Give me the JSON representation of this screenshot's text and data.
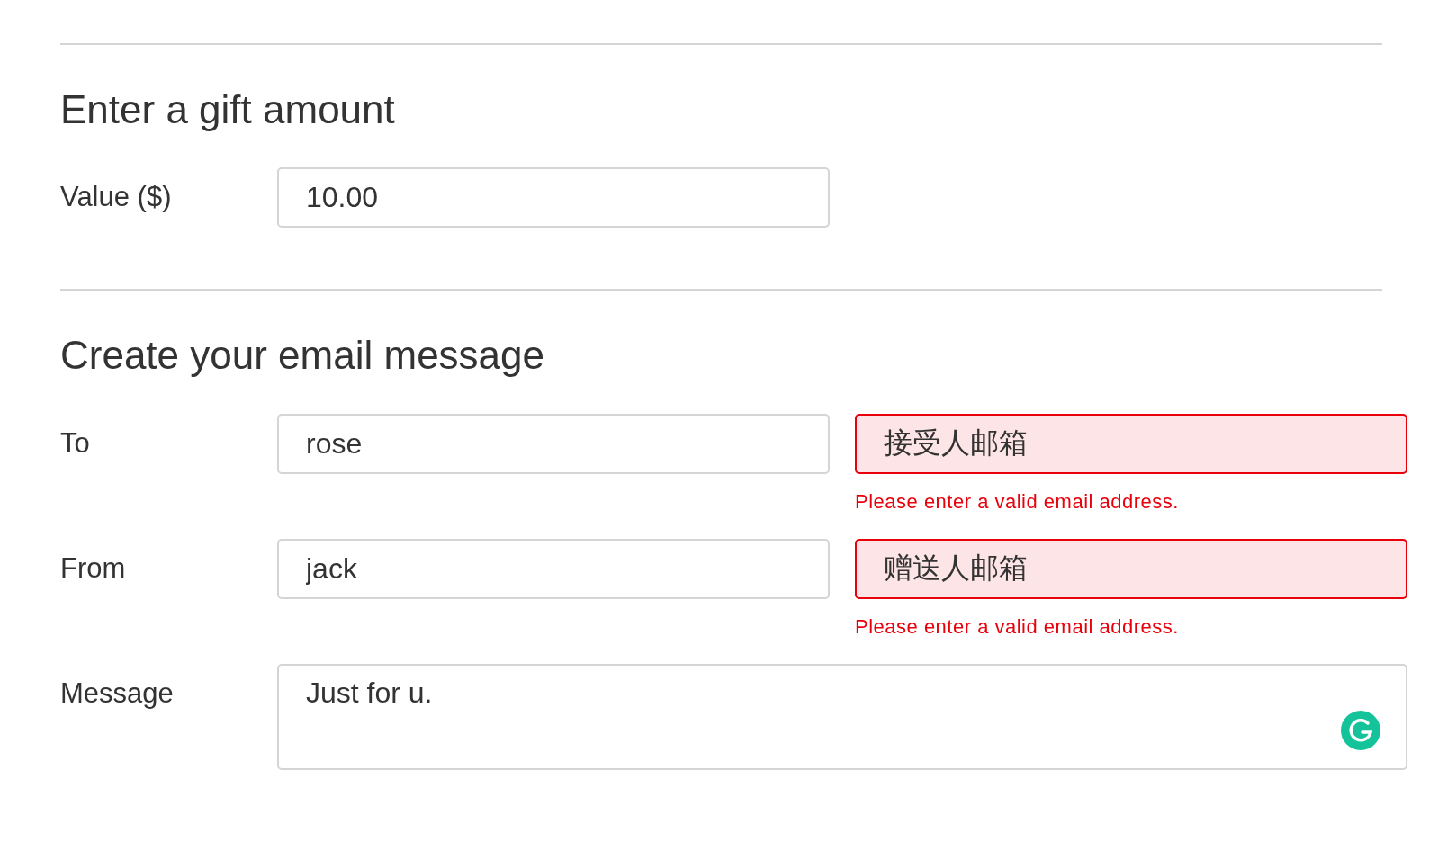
{
  "sections": [
    {
      "title": "Enter a gift amount",
      "fields": [
        {
          "kind": "text",
          "label": "Value ($)",
          "value": "10.00"
        }
      ]
    },
    {
      "title": "Create your email message",
      "fields": [
        {
          "kind": "pair",
          "label": "To",
          "value": "rose",
          "email": {
            "value": "接受人邮箱",
            "invalid": true,
            "error": "Please enter a valid email address."
          }
        },
        {
          "kind": "pair",
          "label": "From",
          "value": "jack",
          "email": {
            "value": "赠送人邮箱",
            "invalid": true,
            "error": "Please enter a valid email address."
          }
        },
        {
          "kind": "textarea",
          "label": "Message",
          "value": "Just for u."
        }
      ]
    }
  ]
}
